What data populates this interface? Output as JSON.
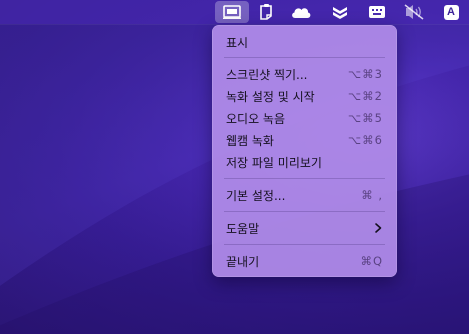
{
  "menubar": {
    "items": [
      {
        "name": "screenshot-icon",
        "active": true
      },
      {
        "name": "clipboard-icon"
      },
      {
        "name": "cloud-icon"
      },
      {
        "name": "layers-icon"
      },
      {
        "name": "keyboard-icon"
      },
      {
        "name": "muted-camera-icon"
      },
      {
        "name": "input-source-icon",
        "text": "A"
      }
    ]
  },
  "menu": {
    "show_label": "표시",
    "screenshot_label": "스크린샷 찍기...",
    "screenshot_shortcut": "⌥⌘3",
    "record_label": "녹화 설정 및 시작",
    "record_shortcut": "⌥⌘2",
    "audio_label": "오디오 녹음",
    "audio_shortcut": "⌥⌘5",
    "webcam_label": "웹캠 녹화",
    "webcam_shortcut": "⌥⌘6",
    "saved_preview_label": "저장 파일 미리보기",
    "preferences_label": "기본 설정...",
    "preferences_shortcut": "⌘ ,",
    "help_label": "도움말",
    "quit_label": "끝내기",
    "quit_shortcut": "⌘Q"
  },
  "colors": {
    "wallpaper": "#4526ad",
    "menu_background": "#b08ce8",
    "menubar_active": "#ffffff"
  }
}
